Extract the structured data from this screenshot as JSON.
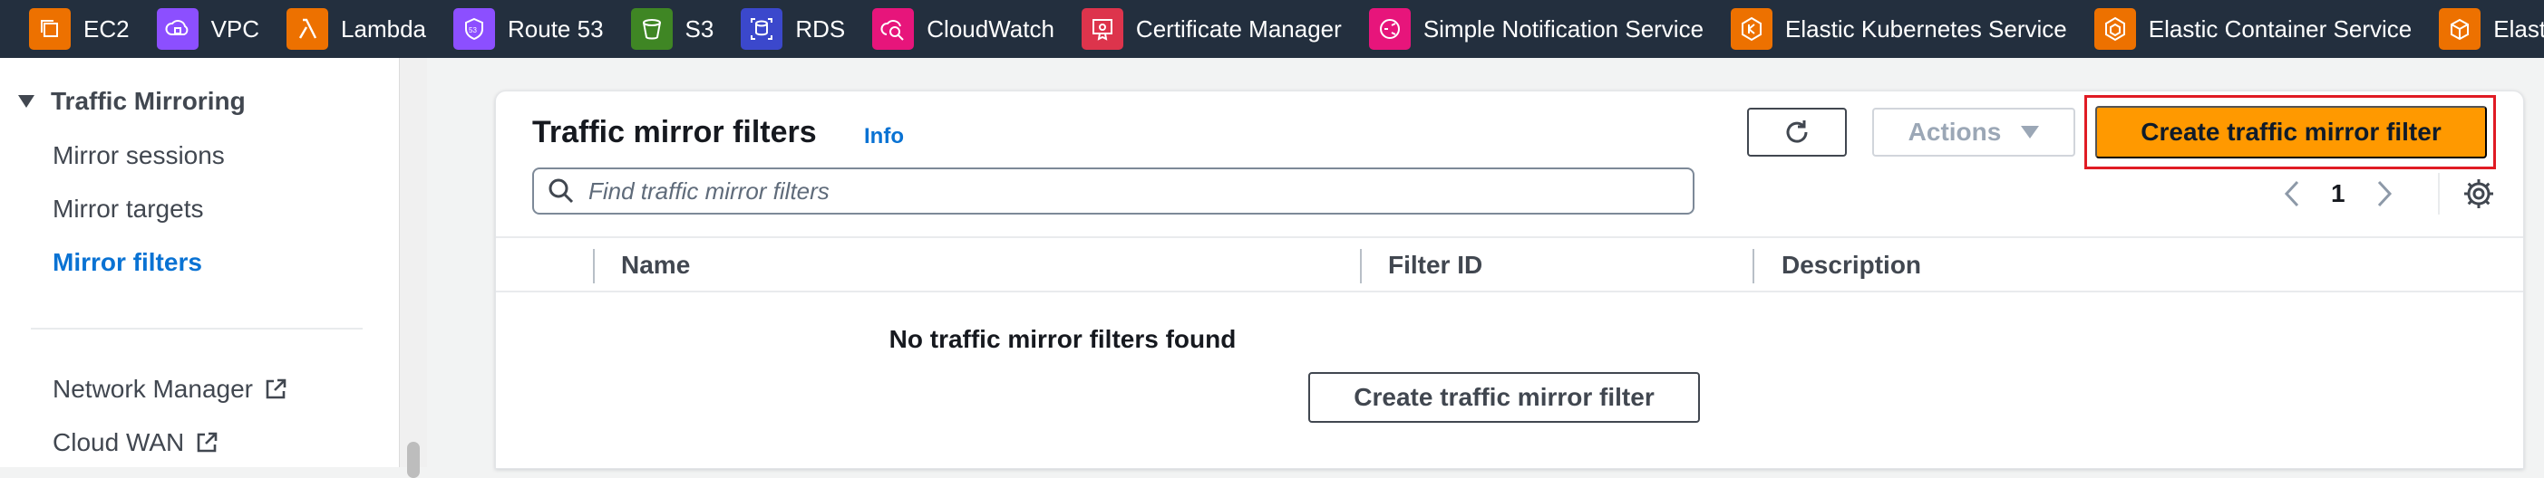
{
  "topbar": {
    "services": [
      {
        "label": "EC2",
        "icon": "ec2-icon",
        "color": "#ed7100"
      },
      {
        "label": "VPC",
        "icon": "vpc-icon",
        "color": "#8c4fff"
      },
      {
        "label": "Lambda",
        "icon": "lambda-icon",
        "color": "#ed7100"
      },
      {
        "label": "Route 53",
        "icon": "route53-icon",
        "color": "#8c4fff"
      },
      {
        "label": "S3",
        "icon": "s3-icon",
        "color": "#3f8624"
      },
      {
        "label": "RDS",
        "icon": "rds-icon",
        "color": "#3b48cc"
      },
      {
        "label": "CloudWatch",
        "icon": "cloudwatch-icon",
        "color": "#e7157b"
      },
      {
        "label": "Certificate Manager",
        "icon": "certificate-manager-icon",
        "color": "#dd344c"
      },
      {
        "label": "Simple Notification Service",
        "icon": "sns-icon",
        "color": "#e7157b"
      },
      {
        "label": "Elastic Kubernetes Service",
        "icon": "eks-icon",
        "color": "#ed7100"
      },
      {
        "label": "Elastic Container Service",
        "icon": "ecs-icon",
        "color": "#ed7100"
      },
      {
        "label": "Elastic Container",
        "icon": "ecr-icon",
        "color": "#ed7100"
      }
    ]
  },
  "sidebar": {
    "section_title": "Traffic Mirroring",
    "items": [
      {
        "label": "Mirror sessions",
        "active": false
      },
      {
        "label": "Mirror targets",
        "active": false
      },
      {
        "label": "Mirror filters",
        "active": true
      }
    ],
    "external_links": [
      {
        "label": "Network Manager",
        "icon": "external-link-icon"
      },
      {
        "label": "Cloud WAN",
        "icon": "external-link-icon"
      }
    ]
  },
  "main": {
    "title": "Traffic mirror filters",
    "info_link": "Info",
    "refresh_icon": "refresh-icon",
    "actions_label": "Actions",
    "primary_button": "Create traffic mirror filter",
    "search_placeholder": "Find traffic mirror filters",
    "pagination": {
      "current_page": "1"
    },
    "settings_icon": "gear-icon",
    "columns": [
      "Name",
      "Filter ID",
      "Description"
    ],
    "empty_state": {
      "message": "No traffic mirror filters found",
      "button_label": "Create traffic mirror filter"
    }
  },
  "colors": {
    "topbar_bg": "#232f3e",
    "primary_button": "#ff9900",
    "link": "#0972d3",
    "highlight": "#e01b24"
  }
}
